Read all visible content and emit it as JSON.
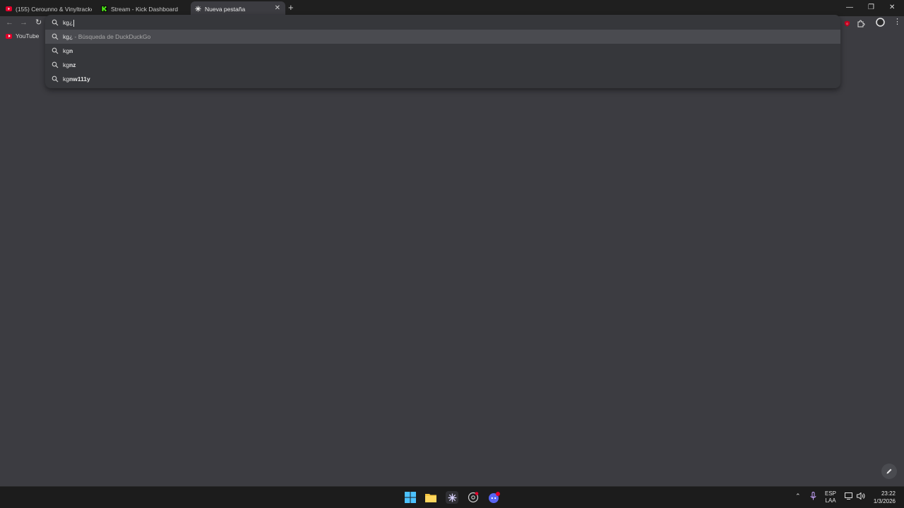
{
  "tabs": [
    {
      "title": "(155) Cerounno & Vinyltracker",
      "favicon": "youtube-icon",
      "color": "#e3002b"
    },
    {
      "title": "Stream - Kick Dashboard",
      "favicon": "kick-icon",
      "color": "#53fc18"
    },
    {
      "title": "Nueva pestaña",
      "favicon": "perplexity-icon",
      "active": true
    }
  ],
  "bookmarks": [
    {
      "label": "YouTube",
      "icon": "youtube-icon"
    }
  ],
  "omnibox": {
    "query": "kg¿",
    "suggestions": [
      {
        "typed": "kg¿",
        "rest": "",
        "sub": " - Búsqueda de DuckDuckGo",
        "selected": true
      },
      {
        "typed": "kg",
        "rest": "n",
        "sub": ""
      },
      {
        "typed": "kg",
        "rest": "nz",
        "sub": ""
      },
      {
        "typed": "kg",
        "rest": "nw111y",
        "sub": ""
      }
    ]
  },
  "taskbar": {
    "apps": [
      "windows-start-icon",
      "file-explorer-icon",
      "perplexity-icon",
      "chrome-icon",
      "discord-icon"
    ],
    "language": "ESP",
    "layout": "LAA",
    "time": "23:22",
    "date": "1/3/2026"
  },
  "colors": {
    "background": "#3c3c41",
    "tabstrip": "#1f1f1f",
    "taskbar": "#1c1c1c",
    "accent_red": "#e3002b"
  }
}
